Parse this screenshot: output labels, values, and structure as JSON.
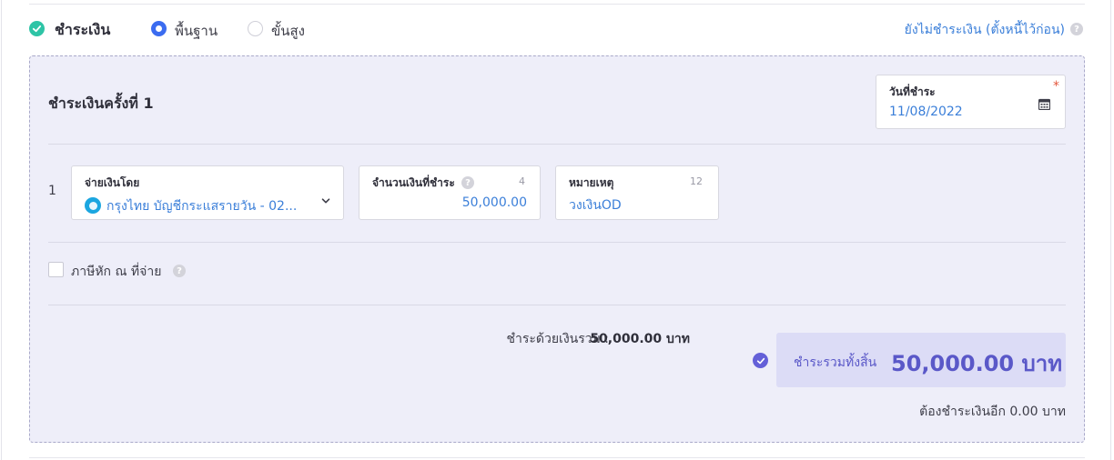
{
  "header": {
    "title": "ชำระเงิน",
    "modes": [
      {
        "label": "พื้นฐาน",
        "selected": true
      },
      {
        "label": "ขั้นสูง",
        "selected": false
      }
    ],
    "unpaid_link": "ยังไม่ชำระเงิน (ตั้งหนี้ไว้ก่อน)"
  },
  "payment": {
    "round_title": "ชำระเงินครั้งที่ 1",
    "date": {
      "label": "วันที่ชำระ",
      "value": "11/08/2022",
      "required_mark": "*"
    },
    "row_number": "1",
    "pay_by": {
      "label": "จ่ายเงินโดย",
      "value": "กรุงไทย บัญชีกระแสรายวัน - 02..."
    },
    "amount": {
      "label": "จำนวนเงินที่ชำระ",
      "value": "50,000.00",
      "counter": "4"
    },
    "note": {
      "label": "หมายเหตุ",
      "value": "วงเงินOD",
      "counter": "12"
    },
    "withholding_tax": {
      "label": "ภาษีหัก ณ ที่จ่าย",
      "checked": false
    },
    "summary": {
      "paid_label": "ชำระด้วยเงินรวม :",
      "paid_value": "50,000.00 บาท",
      "total_label": "ชำระรวมทั้งสิ้น",
      "total_value": "50,000.00 บาท",
      "remaining": "ต้องชำระเงินอีก 0.00 บาท"
    }
  },
  "colors": {
    "accent_green": "#2ec4a6",
    "accent_blue": "#3b6cf0",
    "link_blue": "#3b7fd9",
    "total_purple": "#5a58c8",
    "panel_bg": "#eeeef9"
  }
}
